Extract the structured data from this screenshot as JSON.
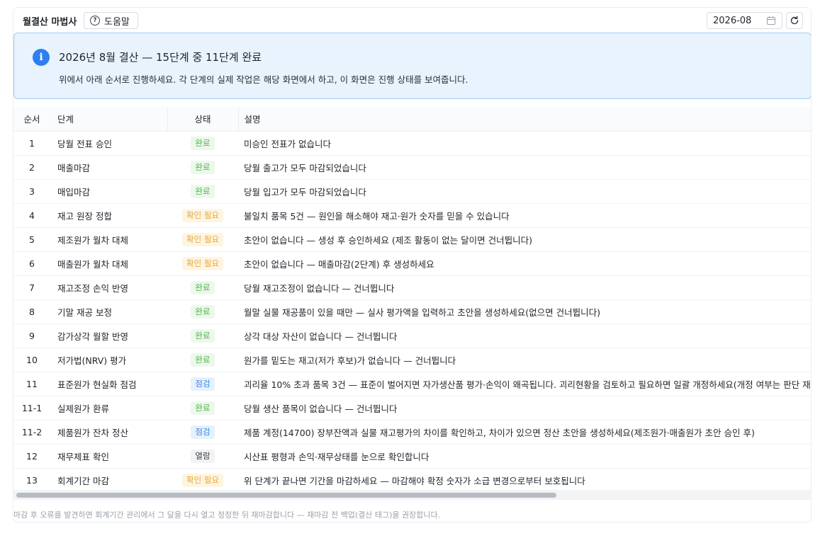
{
  "header": {
    "title": "월결산 마법사",
    "help_label": "도움말",
    "period_value": "2026-08"
  },
  "alert": {
    "title": "2026년 8월 결산 — 15단계 중 11단계 완료",
    "description": "위에서 아래 순서로 진행하세요. 각 단계의 실제 작업은 해당 화면에서 하고, 이 화면은 진행 상태를 보여줍니다."
  },
  "table": {
    "headers": {
      "no": "순서",
      "step": "단계",
      "status": "상태",
      "desc": "설명"
    },
    "rows": [
      {
        "no": "1",
        "step": "당월 전표 승인",
        "status": "완료",
        "kind": "done",
        "desc": "미승인 전표가 없습니다"
      },
      {
        "no": "2",
        "step": "매출마감",
        "status": "완료",
        "kind": "done",
        "desc": "당월 출고가 모두 마감되었습니다"
      },
      {
        "no": "3",
        "step": "매입마감",
        "status": "완료",
        "kind": "done",
        "desc": "당월 입고가 모두 마감되었습니다"
      },
      {
        "no": "4",
        "step": "재고 원장 정합",
        "status": "확인 필요",
        "kind": "check",
        "desc": "불일치 품목 5건 — 원인을 해소해야 재고·원가 숫자를 믿을 수 있습니다"
      },
      {
        "no": "5",
        "step": "제조원가 월차 대체",
        "status": "확인 필요",
        "kind": "check",
        "desc": "초안이 없습니다 — 생성 후 승인하세요 (제조 활동이 없는 달이면 건너뜁니다)"
      },
      {
        "no": "6",
        "step": "매출원가 월차 대체",
        "status": "확인 필요",
        "kind": "check",
        "desc": "초안이 없습니다 — 매출마감(2단계) 후 생성하세요"
      },
      {
        "no": "7",
        "step": "재고조정 손익 반영",
        "status": "완료",
        "kind": "done",
        "desc": "당월 재고조정이 없습니다 — 건너뜁니다"
      },
      {
        "no": "8",
        "step": "기말 재공 보정",
        "status": "완료",
        "kind": "done",
        "desc": "월말 실물 재공품이 있을 때만 — 실사 평가액을 입력하고 초안을 생성하세요(없으면 건너뜁니다)"
      },
      {
        "no": "9",
        "step": "감가상각 월할 반영",
        "status": "완료",
        "kind": "done",
        "desc": "상각 대상 자산이 없습니다 — 건너뜁니다"
      },
      {
        "no": "10",
        "step": "저가법(NRV) 평가",
        "status": "완료",
        "kind": "done",
        "desc": "원가를 밑도는 재고(저가 후보)가 없습니다 — 건너뜁니다"
      },
      {
        "no": "11",
        "step": "표준원가 현실화 점검",
        "status": "점검",
        "kind": "inspect",
        "desc": "괴리율 10% 초과 품목 3건 — 표준이 벌어지면 자가생산품 평가·손익이 왜곡됩니다. 괴리현황을 검토하고 필요하면 일괄 개정하세요(개정 여부는 판단 재량)"
      },
      {
        "no": "11-1",
        "step": "실제원가 환류",
        "status": "완료",
        "kind": "done",
        "desc": "당월 생산 품목이 없습니다 — 건너뜁니다"
      },
      {
        "no": "11-2",
        "step": "제품원가 잔차 정산",
        "status": "점검",
        "kind": "inspect",
        "desc": "제품 계정(14700) 장부잔액과 실물 재고평가의 차이를 확인하고, 차이가 있으면 정산 초안을 생성하세요(제조원가·매출원가 초안 승인 후)"
      },
      {
        "no": "12",
        "step": "재무제표 확인",
        "status": "열람",
        "kind": "view",
        "desc": "시산표 평형과 손익·재무상태를 눈으로 확인합니다"
      },
      {
        "no": "13",
        "step": "회계기간 마감",
        "status": "확인 필요",
        "kind": "check",
        "desc": "위 단계가 끝나면 기간을 마감하세요 — 마감해야 확정 숫자가 소급 변경으로부터 보호됩니다"
      }
    ]
  },
  "footer": {
    "note": "마감 후 오류를 발견하면 회계기간 관리에서 그 달을 다시 열고 정정한 뒤 재마감합니다 — 재마감 전 백업(결산 태그)을 권장합니다."
  }
}
